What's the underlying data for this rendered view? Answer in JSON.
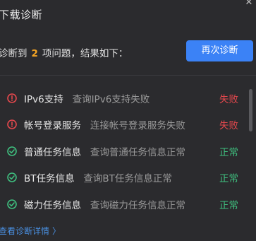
{
  "dialog": {
    "title": "下载诊断",
    "close_glyph": "✕"
  },
  "summary": {
    "prefix": "诊断到",
    "count": "2",
    "suffix": "项问题，结果如下："
  },
  "actions": {
    "rediagnose_label": "再次诊断"
  },
  "colors": {
    "accent": "#3b82f6",
    "fail": "#e5484d",
    "ok": "#3fbf7f",
    "count": "#f5a524"
  },
  "items": [
    {
      "icon": "error-circle-icon",
      "name": "IPv6支持",
      "desc": "查询IPv6支持失败",
      "status": "失败",
      "state": "fail"
    },
    {
      "icon": "error-circle-icon",
      "name": "帐号登录服务",
      "desc": "连接帐号登录服务失败",
      "status": "失败",
      "state": "fail"
    },
    {
      "icon": "check-circle-icon",
      "name": "普通任务信息",
      "desc": "查询普通任务信息正常",
      "status": "正常",
      "state": "ok"
    },
    {
      "icon": "check-circle-icon",
      "name": "BT任务信息",
      "desc": "查询BT任务信息正常",
      "status": "正常",
      "state": "ok"
    },
    {
      "icon": "check-circle-icon",
      "name": "磁力任务信息",
      "desc": "查询磁力任务信息正常",
      "status": "正常",
      "state": "ok"
    }
  ],
  "footer": {
    "details_link": "查看诊断详情",
    "chevron": "〉"
  }
}
